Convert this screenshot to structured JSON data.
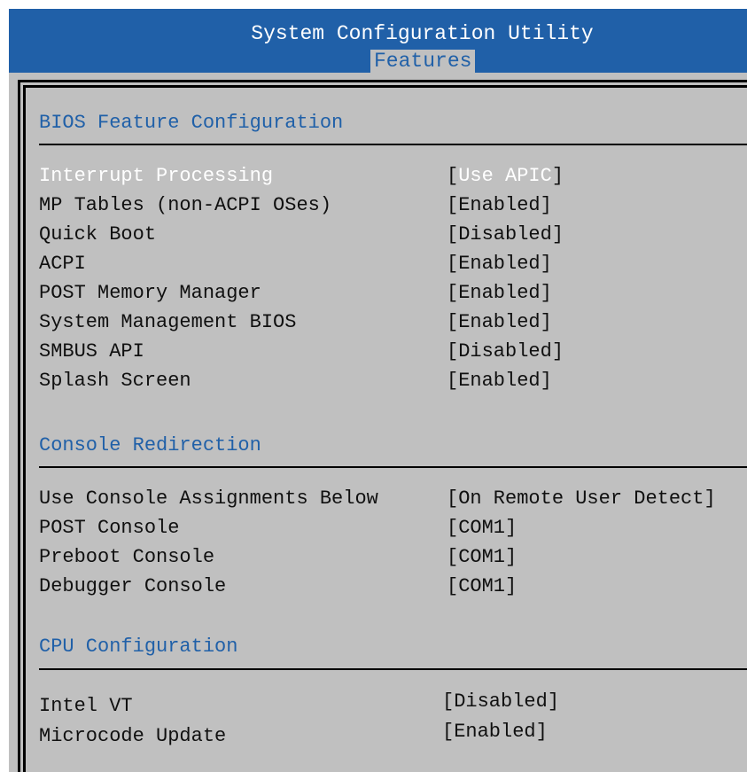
{
  "header": {
    "title": "System Configuration Utility",
    "active_tab": "Features"
  },
  "sections": [
    {
      "title": "BIOS Feature Configuration",
      "items": [
        {
          "label": "Interrupt Processing",
          "value": "Use APIC",
          "selected": true
        },
        {
          "label": "MP Tables (non-ACPI OSes)",
          "value": "Enabled"
        },
        {
          "label": "Quick Boot",
          "value": "Disabled"
        },
        {
          "label": "ACPI",
          "value": "Enabled"
        },
        {
          "label": "POST Memory Manager",
          "value": "Enabled"
        },
        {
          "label": "System Management BIOS",
          "value": "Enabled"
        },
        {
          "label": "SMBUS API",
          "value": "Disabled"
        },
        {
          "label": "Splash Screen",
          "value": "Enabled"
        }
      ]
    },
    {
      "title": "Console Redirection",
      "items": [
        {
          "label": "Use Console Assignments Below",
          "value": "On Remote User Detect"
        },
        {
          "label": "POST Console",
          "value": "COM1"
        },
        {
          "label": "Preboot Console",
          "value": "COM1"
        },
        {
          "label": "Debugger Console",
          "value": "COM1"
        }
      ]
    },
    {
      "title": "CPU Configuration",
      "items": [
        {
          "label": "Intel VT",
          "value": "Disabled"
        },
        {
          "label": "Microcode Update",
          "value": "Enabled"
        }
      ]
    }
  ],
  "colors": {
    "header_bg": "#2060a8",
    "screen_bg": "#c0c0c0",
    "section_title": "#2060a8",
    "selected_text": "#ffffff"
  }
}
